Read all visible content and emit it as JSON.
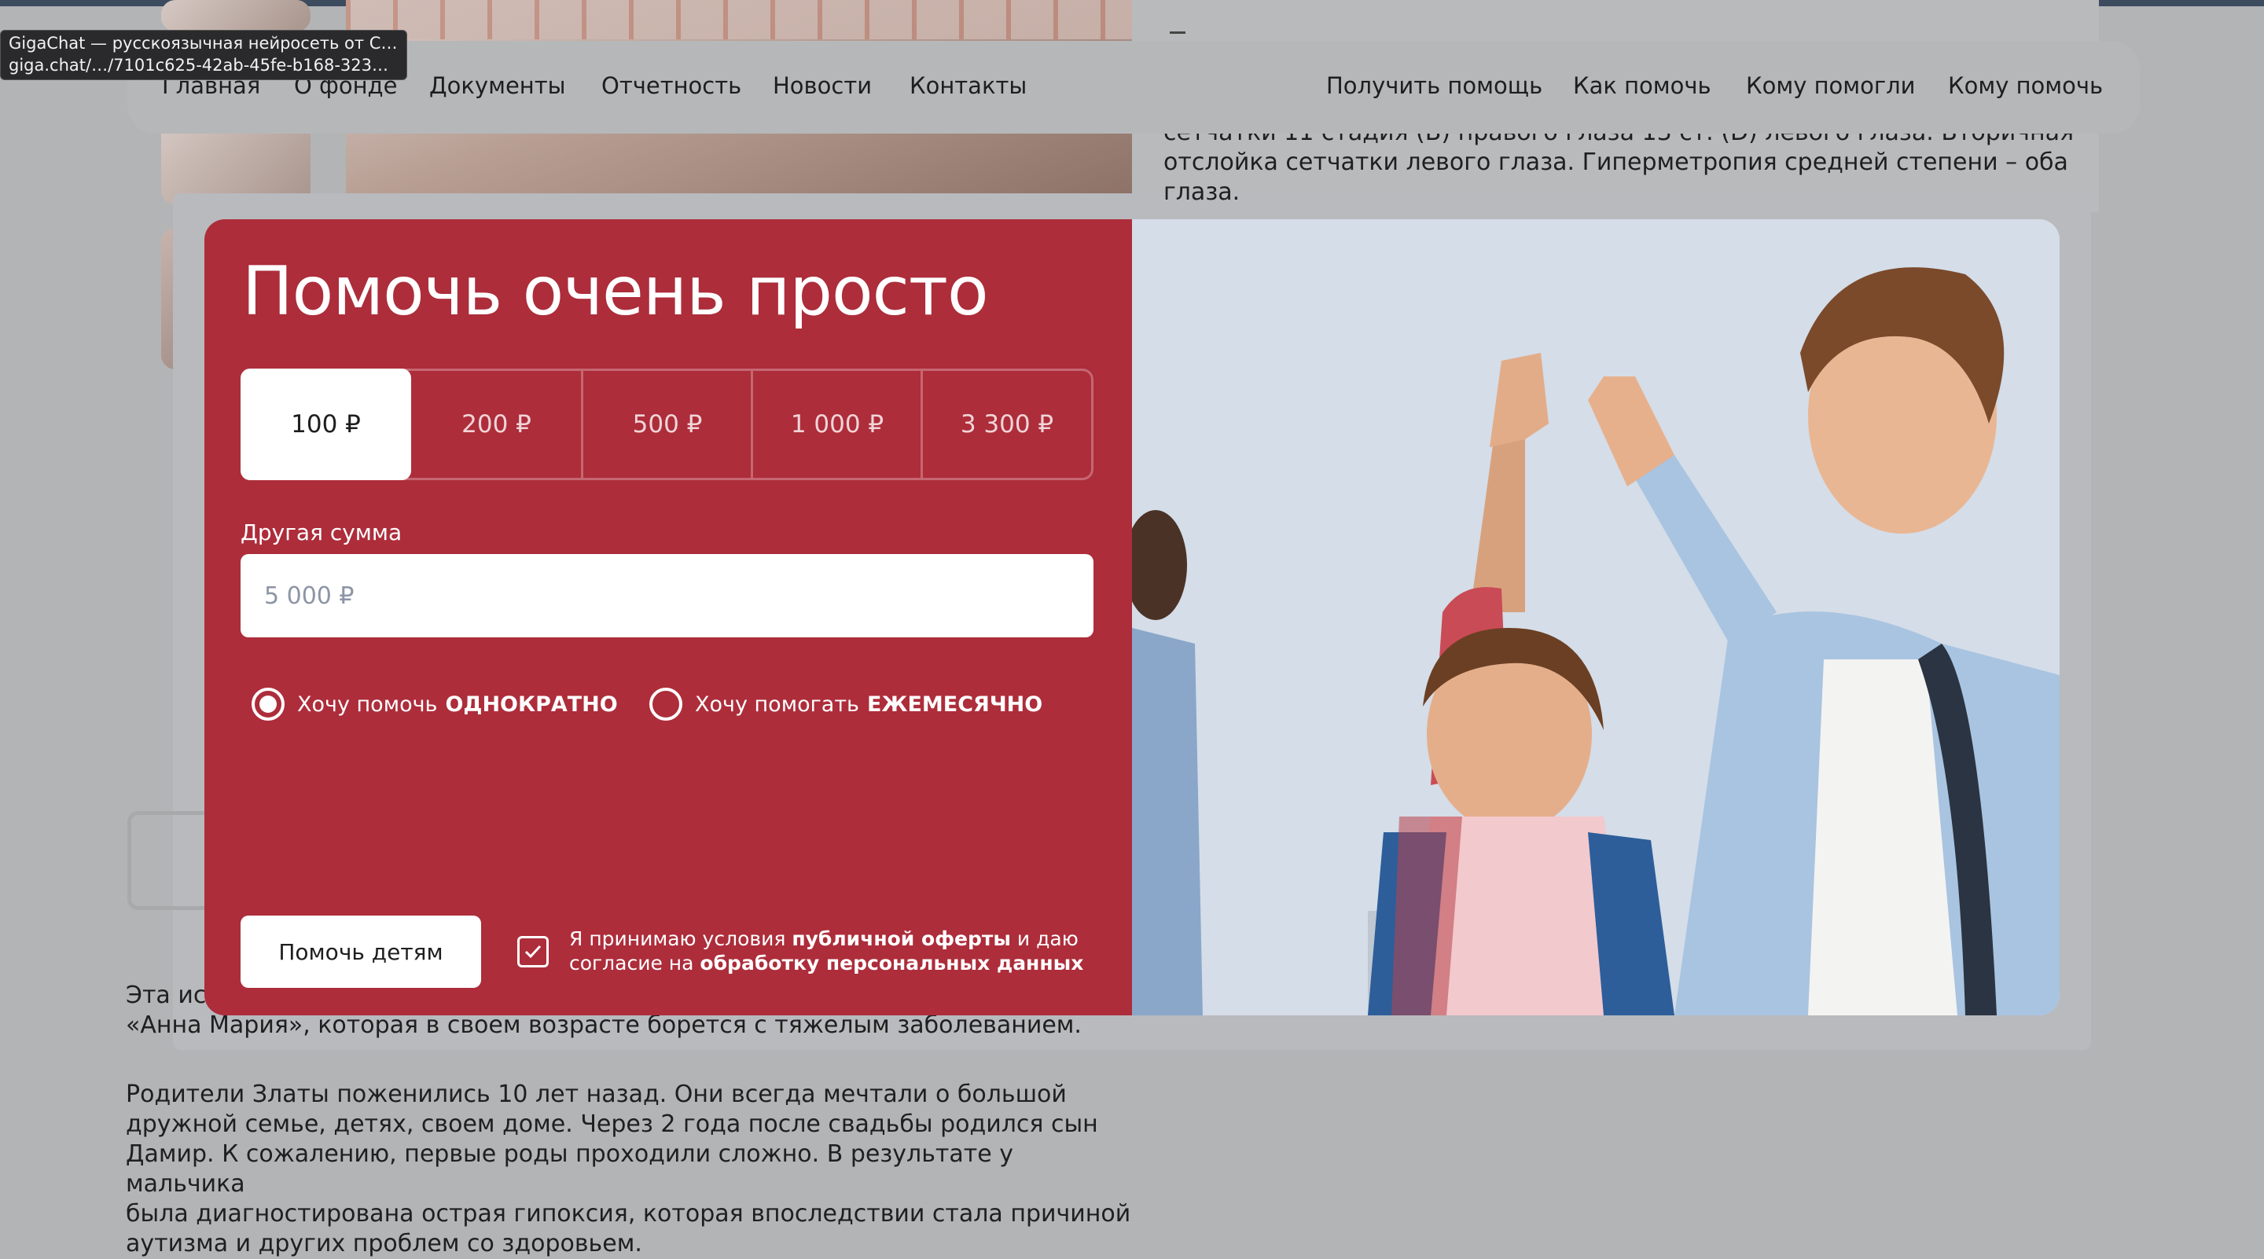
{
  "tooltip": {
    "title": "GigaChat — русскоязычная нейросеть от Сб…",
    "url": "giga.chat/…/7101c625-42ab-45fe-b168-3239…"
  },
  "nav": {
    "left": [
      "Главная",
      "О фонде",
      "Документы",
      "Отчетность",
      "Новости",
      "Контакты"
    ],
    "right": [
      "Получить помощь",
      "Как помочь",
      "Кому помогли",
      "Кому помочь"
    ]
  },
  "background_text": {
    "right_para": [
      "сетчатки 11 стадия (В) правого глаза 13 ст. (D) левого глаза. Вторичная",
      "отслойка сетчатки левого глаза. Гиперметропия средней степени – оба",
      "глаза."
    ],
    "story_intro": [
      "Эта ис",
      "«Анна Мария», которая в своем возрасте борется с тяжелым заболеванием."
    ],
    "story_para": [
      "Родители Златы поженились 10 лет назад. Они всегда мечтали о большой",
      "дружной семье, детях, своем доме. Через 2 года после свадьбы родился сын",
      "Дамир. К сожалению, первые роды проходили сложно. В результате у мальчика",
      "была диагностирована острая гипоксия, которая впоследствии стала причиной",
      "аутизма и других проблем со здоровьем."
    ]
  },
  "modal": {
    "title": "Помочь очень просто",
    "amounts": [
      "100 ₽",
      "200 ₽",
      "500 ₽",
      "1 000 ₽",
      "3 300 ₽"
    ],
    "selected_amount": "100 ₽",
    "other_label": "Другая сумма",
    "other_placeholder": "5 000 ₽",
    "radio_once_prefix": "Хочу помочь",
    "radio_once_strong": "ОДНОКРАТНО",
    "radio_monthly_prefix": "Хочу помогать",
    "radio_monthly_strong": "ЕЖЕМЕСЯЧНО",
    "submit_label": "Помочь детям",
    "consent": {
      "t1": "Я принимаю условия",
      "b1": "публичной оферты",
      "t2": "и даю согласие на",
      "b2": "обработку персональных данных"
    },
    "checkbox_checked": true,
    "accent_color": "#ad2d3b"
  }
}
